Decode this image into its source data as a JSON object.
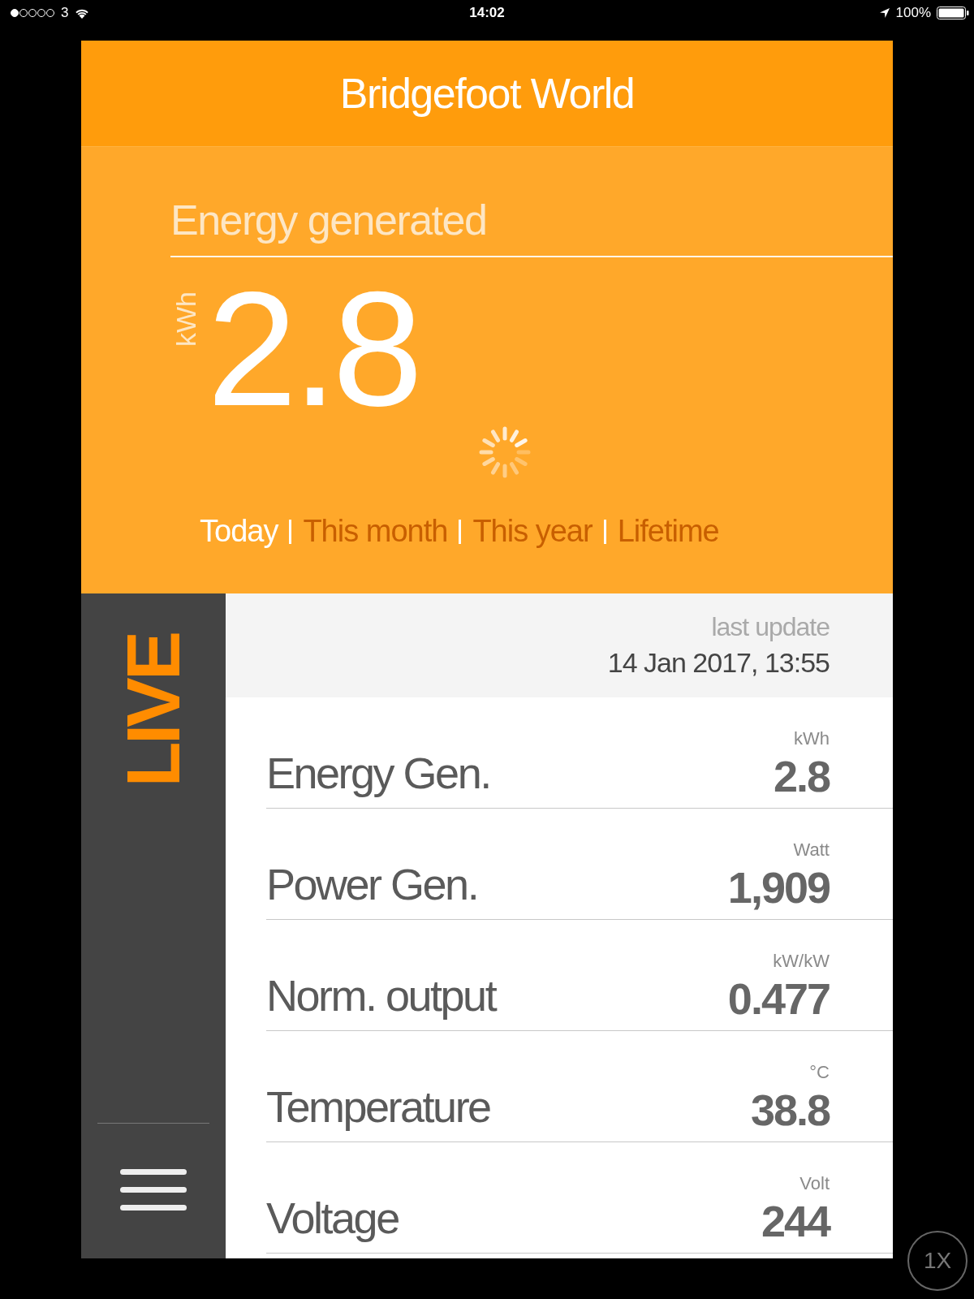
{
  "status_bar": {
    "carrier": "3",
    "time": "14:02",
    "battery": "100%"
  },
  "title": "Bridgefoot World",
  "energy": {
    "heading": "Energy generated",
    "unit": "kWh",
    "value": "2.8",
    "loading": true
  },
  "periods": [
    {
      "label": "Today",
      "selected": true
    },
    {
      "label": "This month",
      "selected": false
    },
    {
      "label": "This year",
      "selected": false
    },
    {
      "label": "Lifetime",
      "selected": false
    }
  ],
  "live": {
    "label": "LIVE"
  },
  "last_update": {
    "label": "last update",
    "value": "14 Jan 2017, 13:55"
  },
  "readings": [
    {
      "name": "Energy Gen.",
      "unit": "kWh",
      "value": "2.8"
    },
    {
      "name": "Power Gen.",
      "unit": "Watt",
      "value": "1,909"
    },
    {
      "name": "Norm. output",
      "unit": "kW/kW",
      "value": "0.477"
    },
    {
      "name": "Temperature",
      "unit": "°C",
      "value": "38.8"
    },
    {
      "name": "Voltage",
      "unit": "Volt",
      "value": "244"
    }
  ],
  "zoom_button": "1X"
}
